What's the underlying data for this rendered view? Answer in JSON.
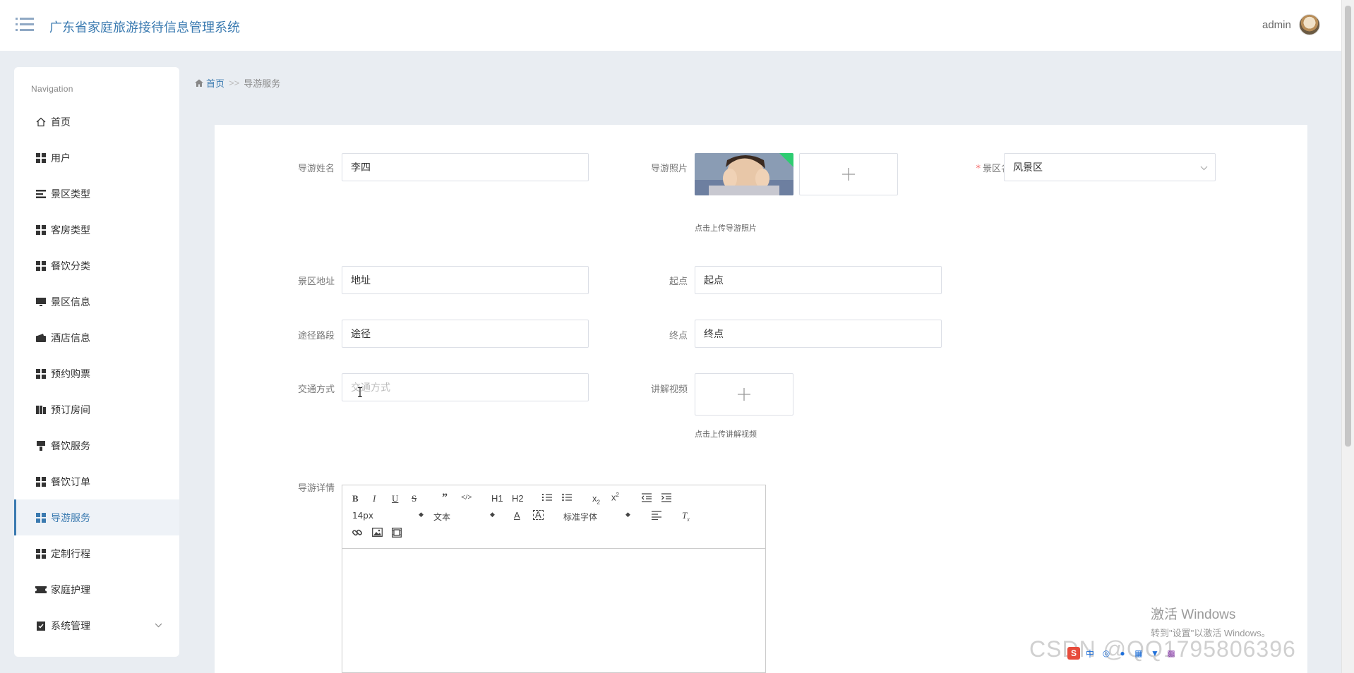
{
  "header": {
    "title": "广东省家庭旅游接待信息管理系统",
    "user": "admin"
  },
  "sidebar": {
    "nav_title": "Navigation",
    "items": [
      {
        "label": "首页",
        "icon": "home-icon"
      },
      {
        "label": "用户",
        "icon": "grid-icon"
      },
      {
        "label": "景区类型",
        "icon": "list-icon"
      },
      {
        "label": "客房类型",
        "icon": "grid-icon"
      },
      {
        "label": "餐饮分类",
        "icon": "grid-icon"
      },
      {
        "label": "景区信息",
        "icon": "monitor-icon"
      },
      {
        "label": "酒店信息",
        "icon": "wallet-icon"
      },
      {
        "label": "预约购票",
        "icon": "grid-icon"
      },
      {
        "label": "预订房间",
        "icon": "book-icon"
      },
      {
        "label": "餐饮服务",
        "icon": "brush-icon"
      },
      {
        "label": "餐饮订单",
        "icon": "grid-icon"
      },
      {
        "label": "导游服务",
        "icon": "grid-icon",
        "active": true
      },
      {
        "label": "定制行程",
        "icon": "grid-icon"
      },
      {
        "label": "家庭护理",
        "icon": "ticket-icon"
      },
      {
        "label": "系统管理",
        "icon": "clipboard-check-icon",
        "expandable": true
      }
    ]
  },
  "breadcrumb": {
    "home": "首页",
    "separator": ">>",
    "current": "导游服务"
  },
  "form": {
    "guide_name": {
      "label": "导游姓名",
      "value": "李四"
    },
    "guide_photo": {
      "label": "导游照片",
      "tip": "点击上传导游照片"
    },
    "scenic_name": {
      "label": "景区名称",
      "required_mark": "*",
      "value": "风景区"
    },
    "scenic_address": {
      "label": "景区地址",
      "value": "地址"
    },
    "start_point": {
      "label": "起点",
      "value": "起点"
    },
    "route": {
      "label": "途径路段",
      "value": "途径"
    },
    "end_point": {
      "label": "终点",
      "value": "终点"
    },
    "transport": {
      "label": "交通方式",
      "placeholder": "交通方式"
    },
    "video": {
      "label": "讲解视频",
      "tip": "点击上传讲解视频"
    },
    "details": {
      "label": "导游详情"
    }
  },
  "editor": {
    "font_size": "14px",
    "text_style": "文本",
    "font_family": "标准字体",
    "h1": "H1",
    "h2": "H2"
  },
  "watermark": {
    "line1": "激活 Windows",
    "line2": "转到\"设置\"以激活 Windows。",
    "csdn": "CSDN @QQ1795806396"
  },
  "colors": {
    "accent": "#3a7ab0",
    "background": "#e9edf2",
    "required": "#f56c6c"
  }
}
